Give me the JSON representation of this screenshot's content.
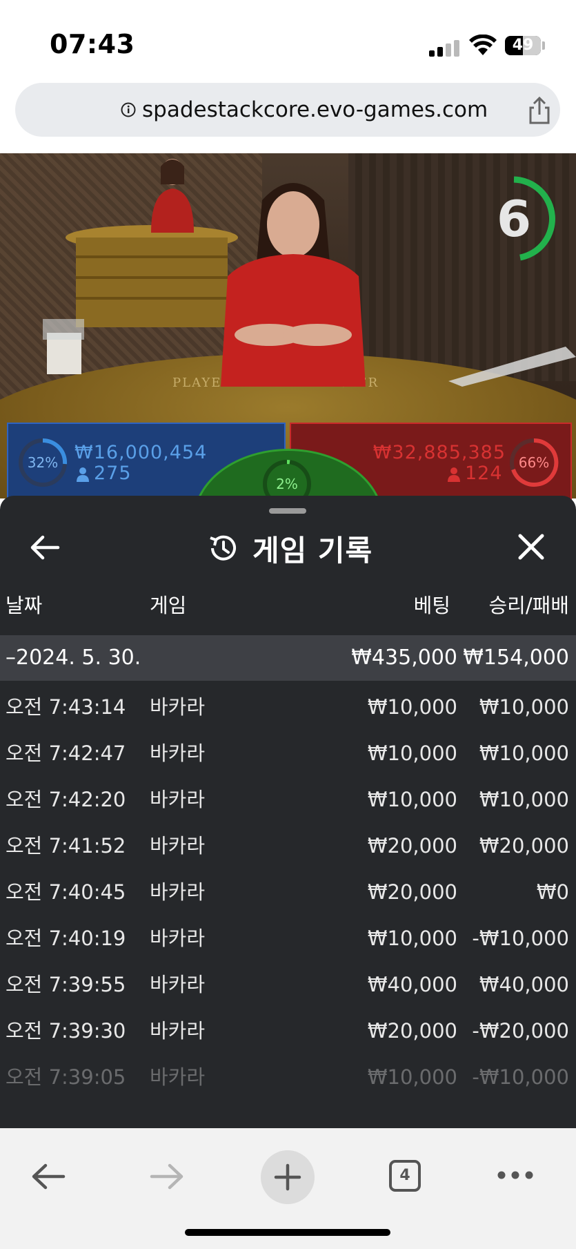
{
  "status_bar": {
    "time": "07:43",
    "battery": "49"
  },
  "browser": {
    "url": "spadestackcore.evo-games.com",
    "tab_count": "4"
  },
  "game_view": {
    "timer": "6",
    "timer_color": "#22b14c",
    "table_labels": {
      "player": "PLAYER",
      "banker": "BANKER"
    },
    "player": {
      "percent": "32%",
      "amount": "₩16,000,454",
      "players": "275",
      "color": "#2f63c0"
    },
    "banker": {
      "percent": "66%",
      "amount": "₩32,885,385",
      "players": "124",
      "color": "#c92a2a"
    },
    "tie": {
      "percent": "2%",
      "color": "#2f9f2f"
    }
  },
  "history": {
    "title": "게임 기록",
    "columns": {
      "date": "날짜",
      "game": "게임",
      "bet": "베팅",
      "result": "승리/패배"
    },
    "day_summary": {
      "date": "–2024. 5. 30.",
      "bet": "₩435,000",
      "result": "₩154,000"
    },
    "rows": [
      {
        "time": "오전 7:43:14",
        "game": "바카라",
        "bet": "₩10,000",
        "result": "₩10,000"
      },
      {
        "time": "오전 7:42:47",
        "game": "바카라",
        "bet": "₩10,000",
        "result": "₩10,000"
      },
      {
        "time": "오전 7:42:20",
        "game": "바카라",
        "bet": "₩10,000",
        "result": "₩10,000"
      },
      {
        "time": "오전 7:41:52",
        "game": "바카라",
        "bet": "₩20,000",
        "result": "₩20,000"
      },
      {
        "time": "오전 7:40:45",
        "game": "바카라",
        "bet": "₩20,000",
        "result": "₩0"
      },
      {
        "time": "오전 7:40:19",
        "game": "바카라",
        "bet": "₩10,000",
        "result": "-₩10,000"
      },
      {
        "time": "오전 7:39:55",
        "game": "바카라",
        "bet": "₩40,000",
        "result": "₩40,000"
      },
      {
        "time": "오전 7:39:30",
        "game": "바카라",
        "bet": "₩20,000",
        "result": "-₩20,000"
      },
      {
        "time": "오전 7:39:05",
        "game": "바카라",
        "bet": "₩10,000",
        "result": "-₩10,000"
      }
    ]
  }
}
